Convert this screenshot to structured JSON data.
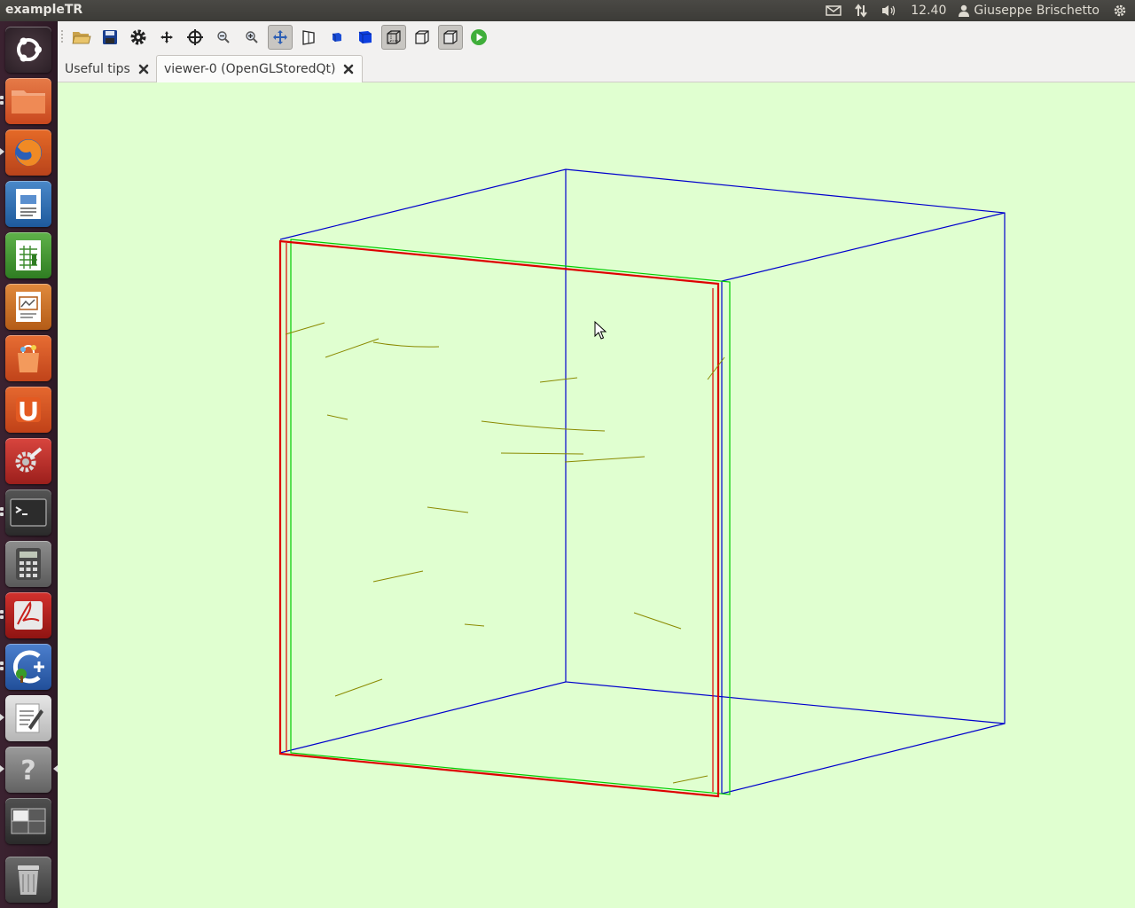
{
  "window": {
    "title": "exampleTR"
  },
  "panel": {
    "clock": "12.40",
    "user": "Giuseppe Brischetto",
    "icons": [
      "mail-icon",
      "network-icon",
      "volume-icon",
      "user-icon",
      "session-gear-icon"
    ]
  },
  "launcher": {
    "items": [
      "ubuntu-dash",
      "files",
      "firefox",
      "libreoffice-writer",
      "libreoffice-calc",
      "libreoffice-impress",
      "software-center",
      "ubuntu-one",
      "system-settings",
      "terminal",
      "calculator",
      "acrobat-reader",
      "cpp-ide",
      "text-editor",
      "help",
      "workspace-switcher",
      "trash"
    ]
  },
  "toolbar": {
    "buttons": [
      "open",
      "save",
      "settings",
      "move",
      "pick",
      "zoom-out",
      "zoom-in",
      "rotate",
      "perspective",
      "front-view",
      "solid-view",
      "hidden-line-view",
      "wireframe",
      "hidden-surface",
      "surface",
      "run"
    ]
  },
  "tabs": [
    {
      "label": "Useful tips",
      "active": false
    },
    {
      "label": "viewer-0 (OpenGLStoredQt)",
      "active": true
    }
  ],
  "viewer": {
    "background": "#e0ffd0",
    "colors": {
      "world": "#0000cc",
      "envelope": "#00cc00",
      "target": "#dd0000",
      "tracks": "#8a8a00"
    }
  }
}
